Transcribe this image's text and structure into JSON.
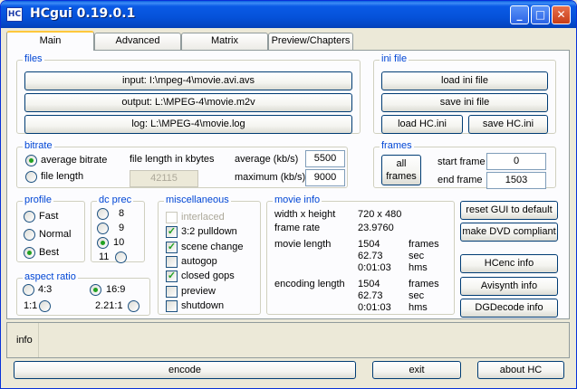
{
  "window": {
    "title": "HCgui 0.19.0.1",
    "icon_text": "HC",
    "controls": {
      "minimize": "_",
      "maximize": "□",
      "close": "✕"
    }
  },
  "tabs": [
    "Main",
    "Advanced",
    "Matrix",
    "Preview/Chapters"
  ],
  "files": {
    "label": "files",
    "input": "input: I:\\mpeg-4\\movie.avi.avs",
    "output": "output: L:\\MPEG-4\\movie.m2v",
    "log": "log: L:\\MPEG-4\\movie.log"
  },
  "ini": {
    "label": "ini file",
    "load": "load ini file",
    "save": "save ini file",
    "load_hc": "load HC.ini",
    "save_hc": "save HC.ini"
  },
  "bitrate": {
    "label": "bitrate",
    "average_bitrate": "average bitrate",
    "file_length": "file length",
    "file_length_kbytes": "file length in kbytes",
    "file_length_value": "42115",
    "average_label": "average (kb/s)",
    "average_value": "5500",
    "maximum_label": "maximum (kb/s)",
    "maximum_value": "9000"
  },
  "frames": {
    "label": "frames",
    "all_frames_line1": "all",
    "all_frames_line2": "frames",
    "start_label": "start frame",
    "start_value": "0",
    "end_label": "end frame",
    "end_value": "1503"
  },
  "profile": {
    "label": "profile",
    "options": [
      "Fast",
      "Normal",
      "Best"
    ],
    "selected": "Best"
  },
  "dcprec": {
    "label": "dc prec",
    "options": [
      "8",
      "9",
      "10",
      "11"
    ],
    "selected": "10"
  },
  "misc": {
    "label": "miscellaneous",
    "items": [
      {
        "label": "interlaced",
        "checked": false,
        "disabled": true
      },
      {
        "label": "3:2 pulldown",
        "checked": true,
        "disabled": false
      },
      {
        "label": "scene change",
        "checked": true,
        "disabled": false
      },
      {
        "label": "autogop",
        "checked": false,
        "disabled": false
      },
      {
        "label": "closed gops",
        "checked": true,
        "disabled": false
      },
      {
        "label": "preview",
        "checked": false,
        "disabled": false
      },
      {
        "label": "shutdown",
        "checked": false,
        "disabled": false
      }
    ]
  },
  "aspect": {
    "label": "aspect ratio",
    "options": [
      "4:3",
      "16:9",
      "1:1",
      "2.21:1"
    ],
    "selected": "16:9"
  },
  "movieinfo": {
    "label": "movie info",
    "width_height_label": "width x height",
    "width_height_value": "720 x 480",
    "frame_rate_label": "frame rate",
    "frame_rate_value": "23.9760",
    "movie_length_label": "movie length",
    "movie_length_frames": "1504",
    "movie_length_sec": "62.73",
    "movie_length_hms": "0:01:03",
    "encoding_length_label": "encoding length",
    "encoding_length_frames": "1504",
    "encoding_length_sec": "62.73",
    "encoding_length_hms": "0:01:03",
    "unit_frames": "frames",
    "unit_sec": "sec",
    "unit_hms": "hms"
  },
  "side_buttons": {
    "reset": "reset GUI to default",
    "dvd": "make DVD compliant",
    "hcenc": "HCenc info",
    "avisynth": "Avisynth info",
    "dgdecode": "DGDecode info"
  },
  "info": {
    "label": "info"
  },
  "bottom": {
    "encode": "encode",
    "exit": "exit",
    "about": "about HC"
  },
  "colors": {
    "group_label": "#0046d5",
    "titlebar": "#0552da",
    "face": "#ece9d8"
  }
}
